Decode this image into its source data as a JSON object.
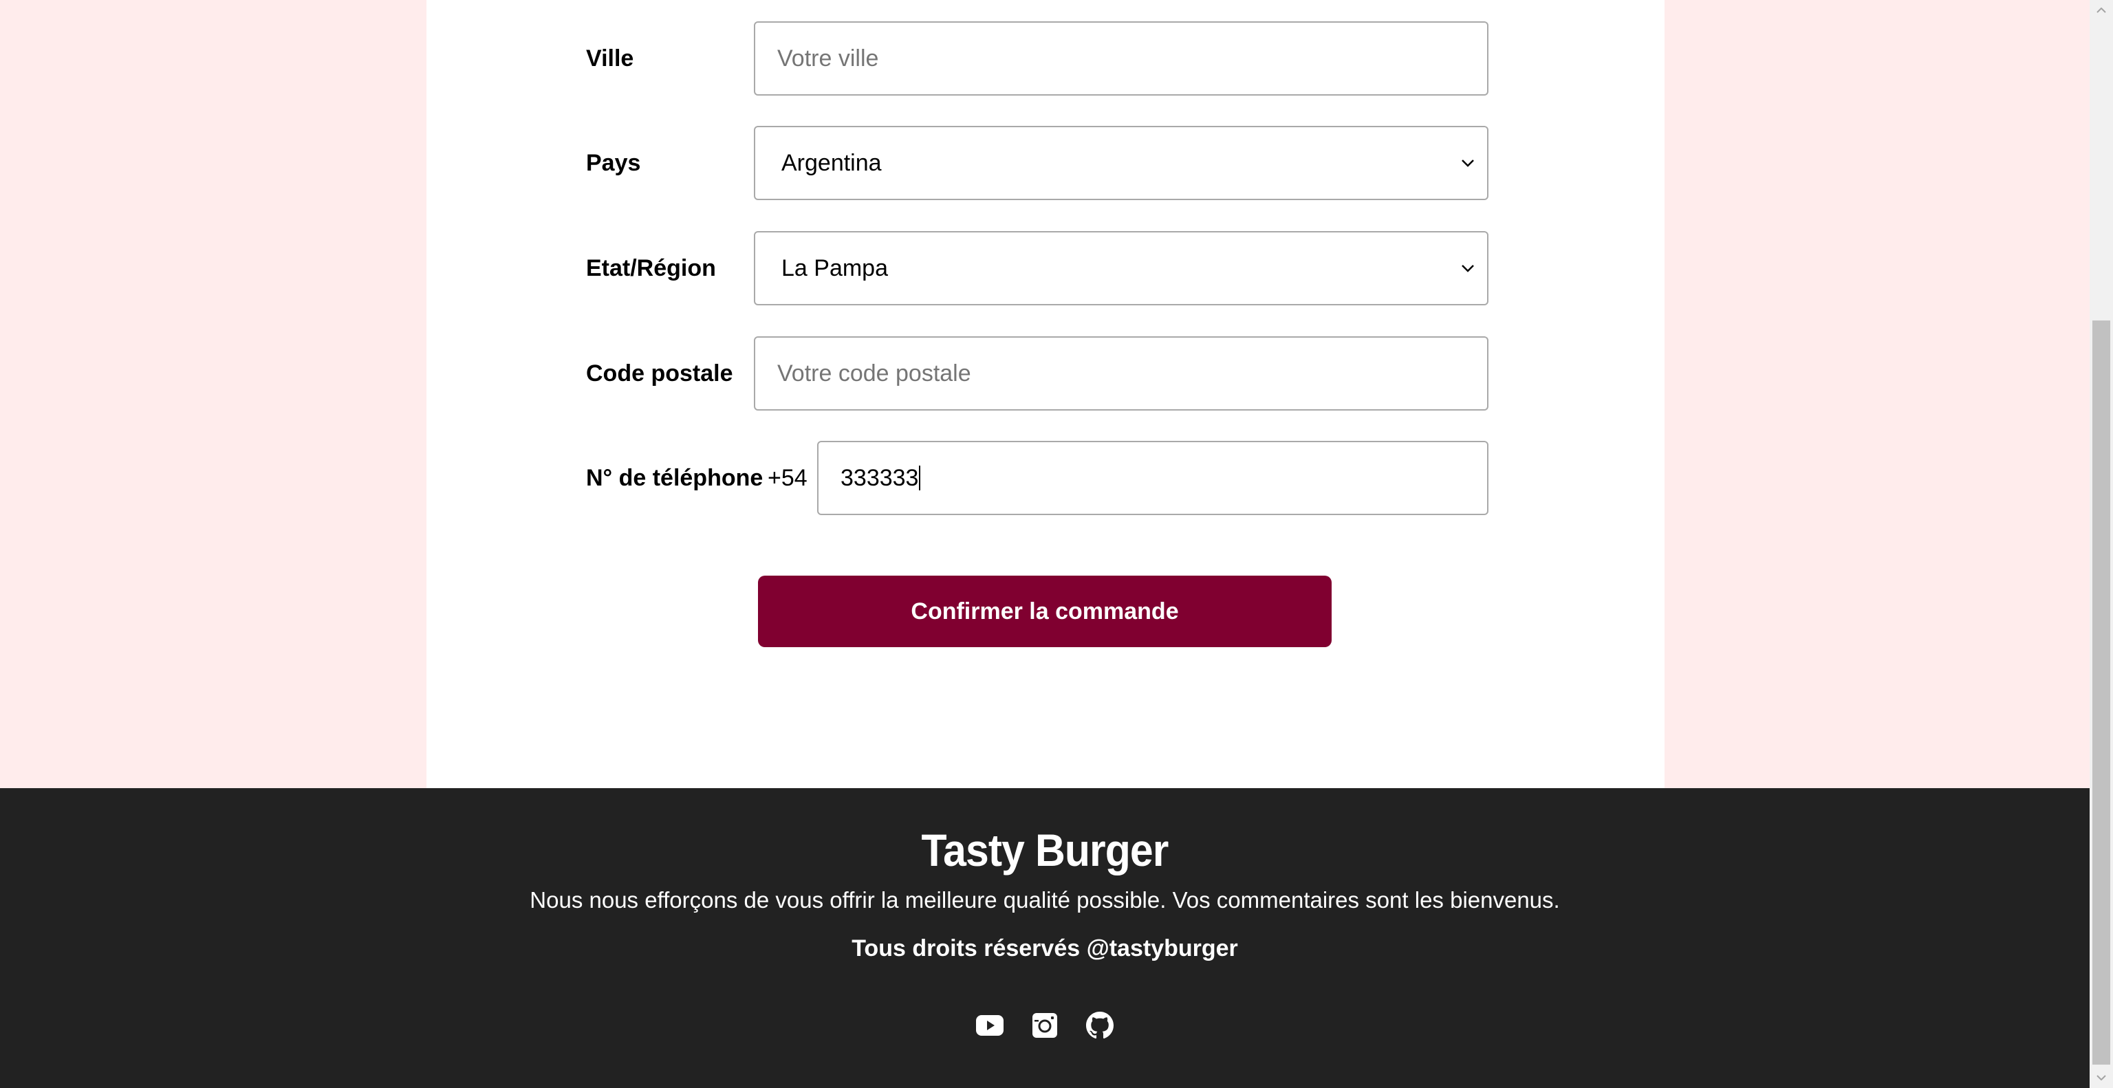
{
  "form": {
    "city": {
      "label": "Ville",
      "placeholder": "Votre ville"
    },
    "country": {
      "label": "Pays",
      "value": "Argentina"
    },
    "region": {
      "label": "Etat/Région",
      "value": "La Pampa"
    },
    "postal": {
      "label": "Code postale",
      "placeholder": "Votre code postale"
    },
    "phone": {
      "label": "N° de téléphone",
      "prefix": "+54",
      "value": "333333"
    },
    "submit_label": "Confirmer la commande"
  },
  "footer": {
    "brand": "Tasty Burger",
    "tagline": "Nous nous efforçons de vous offrir la meilleure qualité possible. Vos commentaires sont les bienvenus.",
    "rights": "Tous droits réservés @tastyburger",
    "socials": [
      "youtube-icon",
      "instagram-icon",
      "github-icon"
    ]
  },
  "colors": {
    "page_bg": "#ffecec",
    "accent": "#800030",
    "footer_bg": "#222222"
  }
}
